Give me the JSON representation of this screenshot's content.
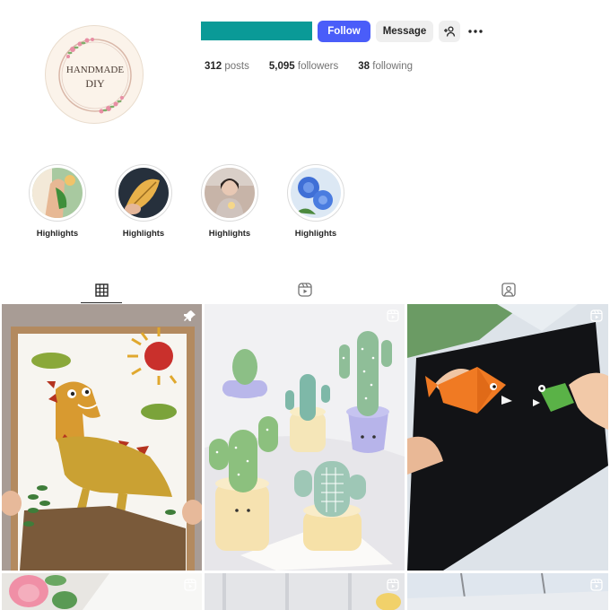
{
  "profile": {
    "avatar_text_line1": "HANDMADE",
    "avatar_text_line2": "DIY",
    "username_bar_color": "#0a9a97",
    "buttons": {
      "follow": "Follow",
      "message": "Message",
      "add_user_icon": "add-person-icon",
      "more_icon": "more-horizontal-icon"
    },
    "accent_color": "#4a5df9",
    "stats": [
      {
        "count": "312",
        "label": "posts"
      },
      {
        "count": "5,095",
        "label": "followers"
      },
      {
        "count": "38",
        "label": "following"
      }
    ]
  },
  "highlights": [
    {
      "label": "Highlights"
    },
    {
      "label": "Highlights"
    },
    {
      "label": "Highlights"
    },
    {
      "label": "Highlights"
    }
  ],
  "tabs": [
    {
      "name": "posts",
      "icon": "grid-icon",
      "active": true
    },
    {
      "name": "reels",
      "icon": "reels-icon",
      "active": false
    },
    {
      "name": "tagged",
      "icon": "tagged-icon",
      "active": false
    }
  ],
  "posts": [
    {
      "subject": "leaf dinosaur craft",
      "badge": "pin-icon"
    },
    {
      "subject": "clay cactus pots",
      "badge": "reel-icon"
    },
    {
      "subject": "origami fish and frog",
      "badge": "reel-icon"
    },
    {
      "subject": "pink flowers",
      "badge": "reel-icon"
    },
    {
      "subject": "craft video",
      "badge": "reel-icon"
    },
    {
      "subject": "craft video",
      "badge": "reel-icon"
    }
  ]
}
